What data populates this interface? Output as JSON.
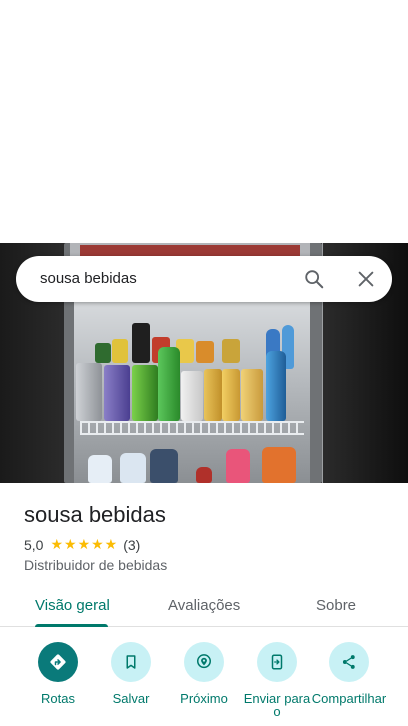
{
  "search": {
    "query": "sousa bebidas"
  },
  "place": {
    "name": "sousa bebidas",
    "rating": "5,0",
    "stars": "★★★★★",
    "review_count": "(3)",
    "category": "Distribuidor de bebidas"
  },
  "tabs": [
    {
      "label": "Visão geral",
      "active": true
    },
    {
      "label": "Avaliações",
      "active": false
    },
    {
      "label": "Sobre",
      "active": false
    }
  ],
  "actions": [
    {
      "label": "Rotas",
      "icon": "directions-icon"
    },
    {
      "label": "Salvar",
      "icon": "bookmark-icon"
    },
    {
      "label": "Próximo",
      "icon": "nearby-icon"
    },
    {
      "label": "Enviar para o",
      "icon": "send-to-phone-icon"
    },
    {
      "label": "Compartilhar",
      "icon": "share-icon"
    }
  ],
  "colors": {
    "accent": "#00796b",
    "primary_button": "#0a7a7a",
    "button_bg": "#c8f1f5",
    "stars": "#fbbc04"
  }
}
